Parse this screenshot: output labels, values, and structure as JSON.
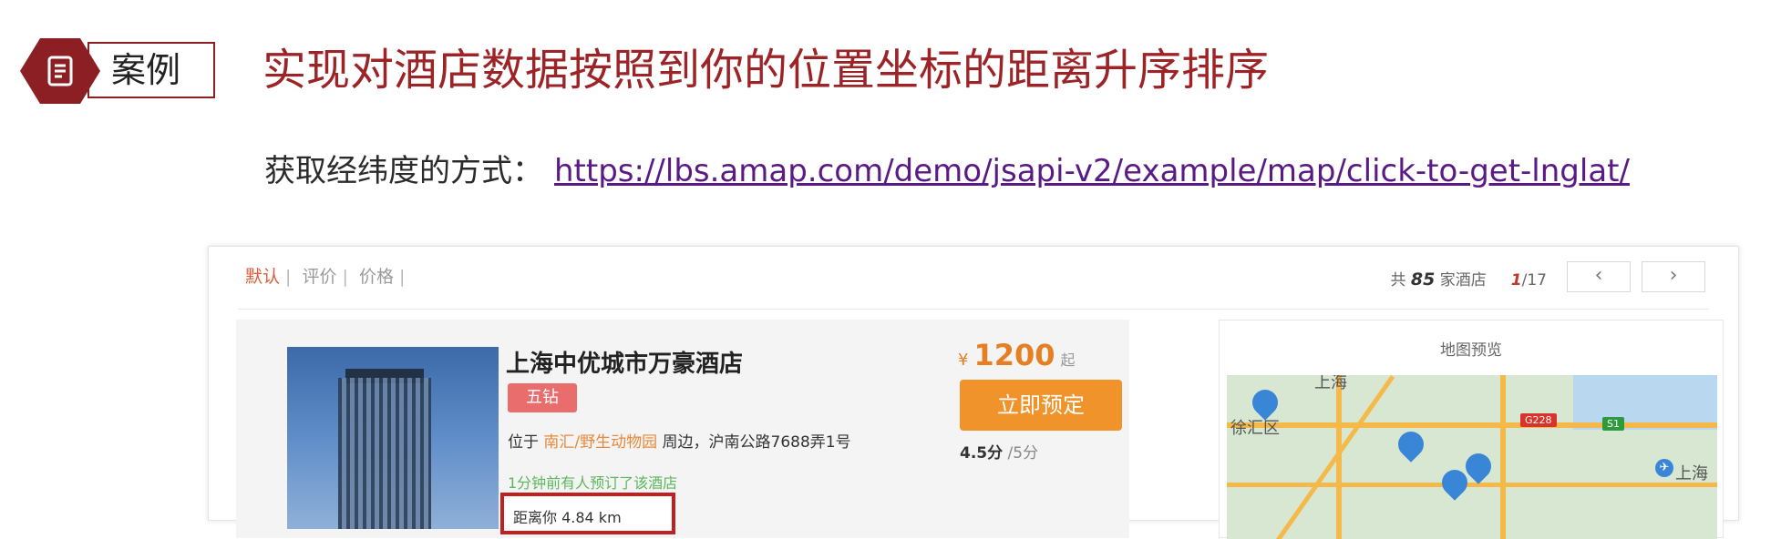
{
  "header": {
    "badge_label": "案例",
    "title": "实现对酒店数据按照到你的位置坐标的距离升序排序",
    "method_label": "获取经纬度的方式：",
    "method_link": "https://lbs.amap.com/demo/jsapi-v2/example/map/click-to-get-lnglat/"
  },
  "sort_bar": {
    "items": [
      "默认",
      "评价",
      "价格"
    ],
    "separator": "|"
  },
  "results": {
    "prefix": "共",
    "count": "85",
    "suffix": "家酒店",
    "page_current": "1",
    "page_total": "/17",
    "prev": "‹",
    "next": "›"
  },
  "hotel": {
    "name": "上海中优城市万豪酒店",
    "star": "五钻",
    "location_prefix": "位于",
    "location_area": "南汇/野生动物园",
    "location_suffix": "周边，沪南公路7688弄1号",
    "booked_hint": "1分钟前有人预订了该酒店",
    "distance": "距离你 4.84 km",
    "price_symbol": "¥",
    "price": "1200",
    "price_unit": "起",
    "book_button": "立即预定",
    "rating": "4.5分",
    "rating_max": "/5分"
  },
  "map": {
    "title": "地图预览",
    "labels": [
      "上海",
      "徐汇区",
      "上海"
    ],
    "road_signs": [
      "G228",
      "S1"
    ]
  },
  "colors": {
    "title": "#9c2427",
    "badge": "#8b1f24",
    "price": "#e67e22",
    "book_button": "#f0932b",
    "distance_border": "#c02020"
  }
}
